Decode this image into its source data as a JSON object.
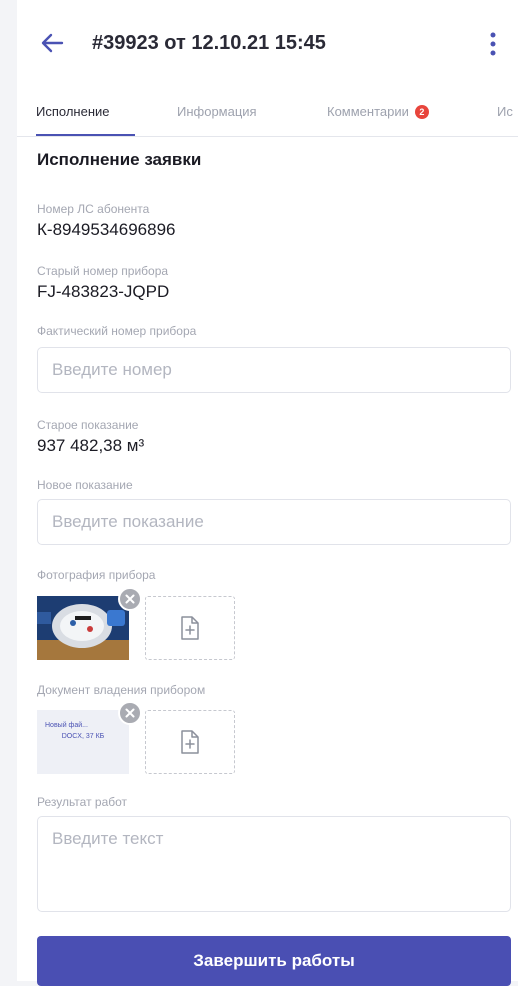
{
  "header": {
    "title": "#39923 от 12.10.21 15:45",
    "icons": {
      "back": "arrow-left-icon",
      "menu": "more-vertical-icon"
    }
  },
  "tabs": [
    {
      "label": "Исполнение",
      "active": true
    },
    {
      "label": "Информация",
      "active": false
    },
    {
      "label": "Комментарии",
      "active": false,
      "badge": "2"
    },
    {
      "label": "Ис",
      "active": false
    }
  ],
  "section": {
    "title": "Исполнение заявки"
  },
  "fields": {
    "account": {
      "label": "Номер ЛС абонента",
      "value": "К-8949534696896"
    },
    "old_device": {
      "label": "Старый номер прибора",
      "value": "FJ-483823-JQPD"
    },
    "actual_device": {
      "label": "Фактический номер прибора",
      "value": "",
      "placeholder": "Введите номер"
    },
    "old_reading": {
      "label": "Старое показание",
      "value": "937 482,38 м³"
    },
    "new_reading": {
      "label": "Новое показание",
      "value": "",
      "placeholder": "Введите показание"
    },
    "photo": {
      "label": "Фотография прибора"
    },
    "ownership_doc": {
      "label": "Документ владения прибором",
      "file_name": "Новый фай...",
      "file_meta": "DOCX, 37 КБ"
    },
    "work_result": {
      "label": "Результат работ",
      "value": "",
      "placeholder": "Введите текст"
    }
  },
  "actions": {
    "submit_label": "Завершить работы"
  },
  "colors": {
    "accent": "#4a4fb3",
    "badge": "#e8453c",
    "label": "#a4a7b2",
    "background": "#f3f4f7"
  }
}
